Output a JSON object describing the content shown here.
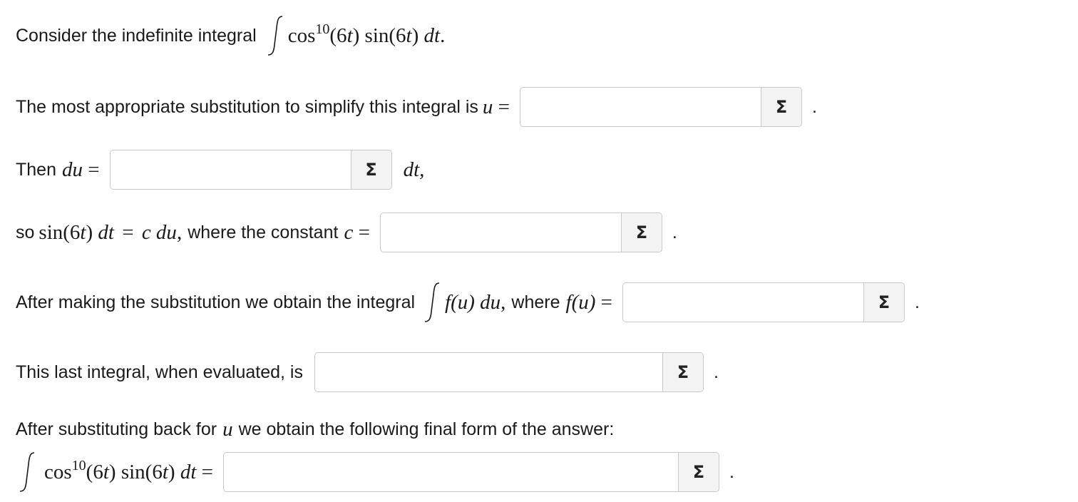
{
  "q0": {
    "text": "Consider the indefinite integral",
    "integrand_func": "cos",
    "power": "10",
    "rest": "(6",
    "t1": "t",
    "mid": ") sin(6",
    "t2": "t",
    "close": ")",
    "dt": "dt",
    "period": "."
  },
  "q1": {
    "text": "The most appropriate substitution to simplify this integral is",
    "var": "u",
    "eq": "=",
    "period": "."
  },
  "q2": {
    "text": "Then",
    "var": "du",
    "eq": "=",
    "after": "dt,"
  },
  "q3": {
    "prefix": "so",
    "expr1": "sin(6",
    "t": "t",
    "expr2": ")",
    "dt": "dt",
    "eq": "=",
    "cdu": "c du",
    "comma": ",",
    "text": "where the constant",
    "c": "c",
    "eq2": "=",
    "period": "."
  },
  "q4": {
    "text": "After making the substitution we obtain the integral",
    "fu": "f(u)",
    "du": "du",
    "comma": ",",
    "where": "where",
    "fu2": "f(u)",
    "eq": "=",
    "period": "."
  },
  "q5": {
    "text": "This last integral, when evaluated, is",
    "period": "."
  },
  "q6": {
    "text1": "After substituting back for",
    "var": "u",
    "text2": "we obtain the following final form of the answer:",
    "func": "cos",
    "power": "10",
    "rest": "(6",
    "t1": "t",
    "mid": ") sin(6",
    "t2": "t",
    "close": ")",
    "dt": "dt",
    "eq": "=",
    "period": "."
  },
  "sigma_label": "Σ"
}
